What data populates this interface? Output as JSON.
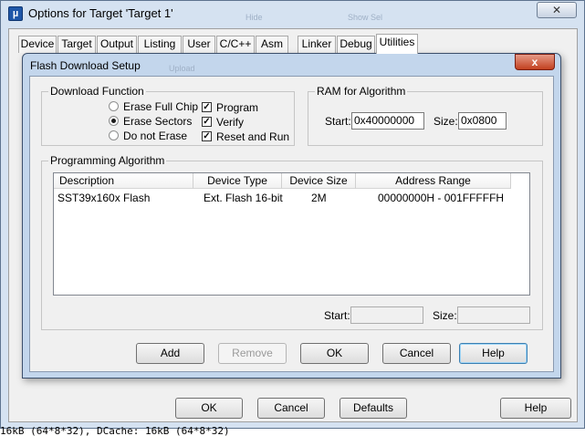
{
  "outer": {
    "title": "Options for Target 'Target 1'",
    "app_icon_glyph": "µ",
    "close_label": "✕",
    "ghost_left": "Hide",
    "ghost_right": "Show Sel"
  },
  "tabs": [
    {
      "label": "Device"
    },
    {
      "label": "Target"
    },
    {
      "label": "Output"
    },
    {
      "label": "Listing"
    },
    {
      "label": "User"
    },
    {
      "label": "C/C++"
    },
    {
      "label": "Asm"
    },
    {
      "label": "Linker"
    },
    {
      "label": "Debug"
    },
    {
      "label": "Utilities"
    }
  ],
  "outer_buttons": {
    "ok": "OK",
    "cancel": "Cancel",
    "defaults": "Defaults",
    "help": "Help"
  },
  "dialog": {
    "title": "Flash Download Setup",
    "ghost_behind": "Upload",
    "close_label": "x",
    "download_function": {
      "label": "Download Function",
      "radios": [
        {
          "label": "Erase Full Chip",
          "selected": false
        },
        {
          "label": "Erase Sectors",
          "selected": true
        },
        {
          "label": "Do not Erase",
          "selected": false
        }
      ],
      "checks": [
        {
          "label": "Program",
          "checked": true
        },
        {
          "label": "Verify",
          "checked": true
        },
        {
          "label": "Reset and Run",
          "checked": true
        }
      ]
    },
    "ram": {
      "label": "RAM for Algorithm",
      "start_label": "Start:",
      "start_value": "0x40000000",
      "size_label": "Size:",
      "size_value": "0x0800"
    },
    "algorithm": {
      "label": "Programming Algorithm",
      "columns": [
        "Description",
        "Device Type",
        "Device Size",
        "Address Range"
      ],
      "rows": [
        {
          "description": "SST39x160x Flash",
          "device_type": "Ext. Flash 16-bit",
          "device_size": "2M",
          "address_range": "00000000H - 001FFFFFH"
        }
      ],
      "start_label": "Start:",
      "start_value": "",
      "size_label": "Size:",
      "size_value": ""
    },
    "buttons": {
      "add": "Add",
      "remove": "Remove",
      "ok": "OK",
      "cancel": "Cancel",
      "help": "Help"
    },
    "check_glyph": "✓"
  },
  "status_line": "16kB (64*8*32), DCache: 16kB (64*8*32)"
}
